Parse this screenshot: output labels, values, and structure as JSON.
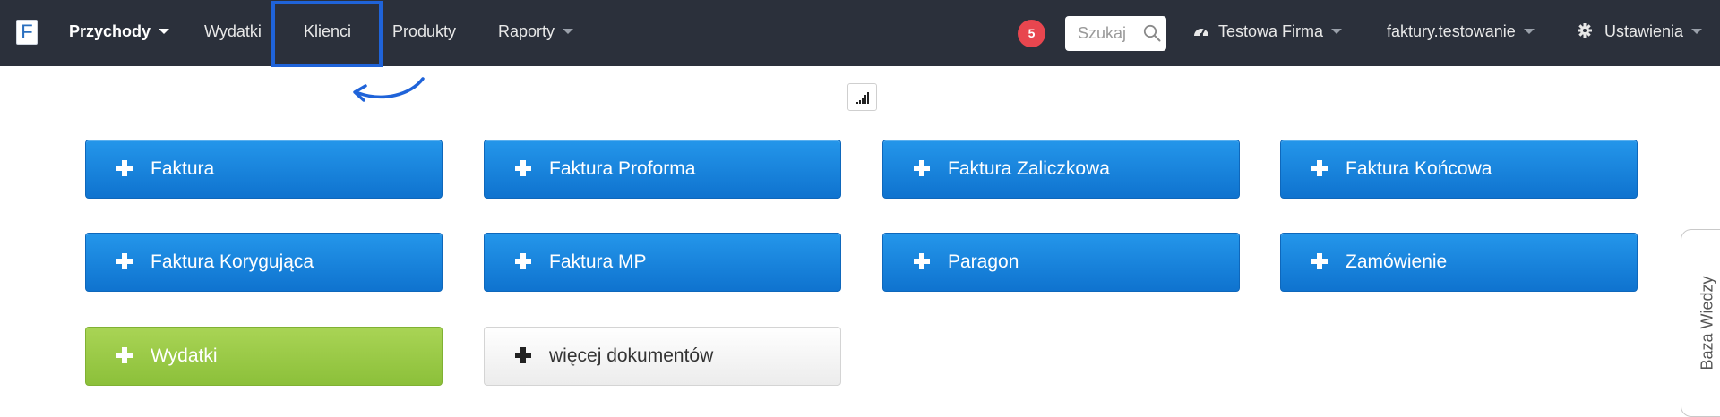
{
  "nav": {
    "logo": "F",
    "items": [
      {
        "label": "Przychody",
        "dropdown": true,
        "active": true
      },
      {
        "label": "Wydatki",
        "dropdown": false
      },
      {
        "label": "Klienci",
        "dropdown": false,
        "highlighted": true
      },
      {
        "label": "Produkty",
        "dropdown": false
      },
      {
        "label": "Raporty",
        "dropdown": true
      }
    ],
    "notifications": "5",
    "search_placeholder": "Szukaj",
    "company": "Testowa Firma",
    "account": "faktury.testowanie",
    "settings": "Ustawienia"
  },
  "colors": {
    "navbar": "#2b303b",
    "highlight": "#1f63d9",
    "badge": "#e8464f",
    "blue_button": "#1a86e0",
    "green_button": "#9bcb46"
  },
  "buttons": [
    {
      "label": "Faktura",
      "style": "blue"
    },
    {
      "label": "Faktura Proforma",
      "style": "blue"
    },
    {
      "label": "Faktura Zaliczkowa",
      "style": "blue"
    },
    {
      "label": "Faktura Końcowa",
      "style": "blue"
    },
    {
      "label": "Faktura Korygująca",
      "style": "blue"
    },
    {
      "label": "Faktura MP",
      "style": "blue"
    },
    {
      "label": "Paragon",
      "style": "blue"
    },
    {
      "label": "Zamówienie",
      "style": "blue"
    },
    {
      "label": "Wydatki",
      "style": "green"
    },
    {
      "label": "więcej dokumentów",
      "style": "gray"
    }
  ],
  "side_tab": "Baza Wiedzy"
}
